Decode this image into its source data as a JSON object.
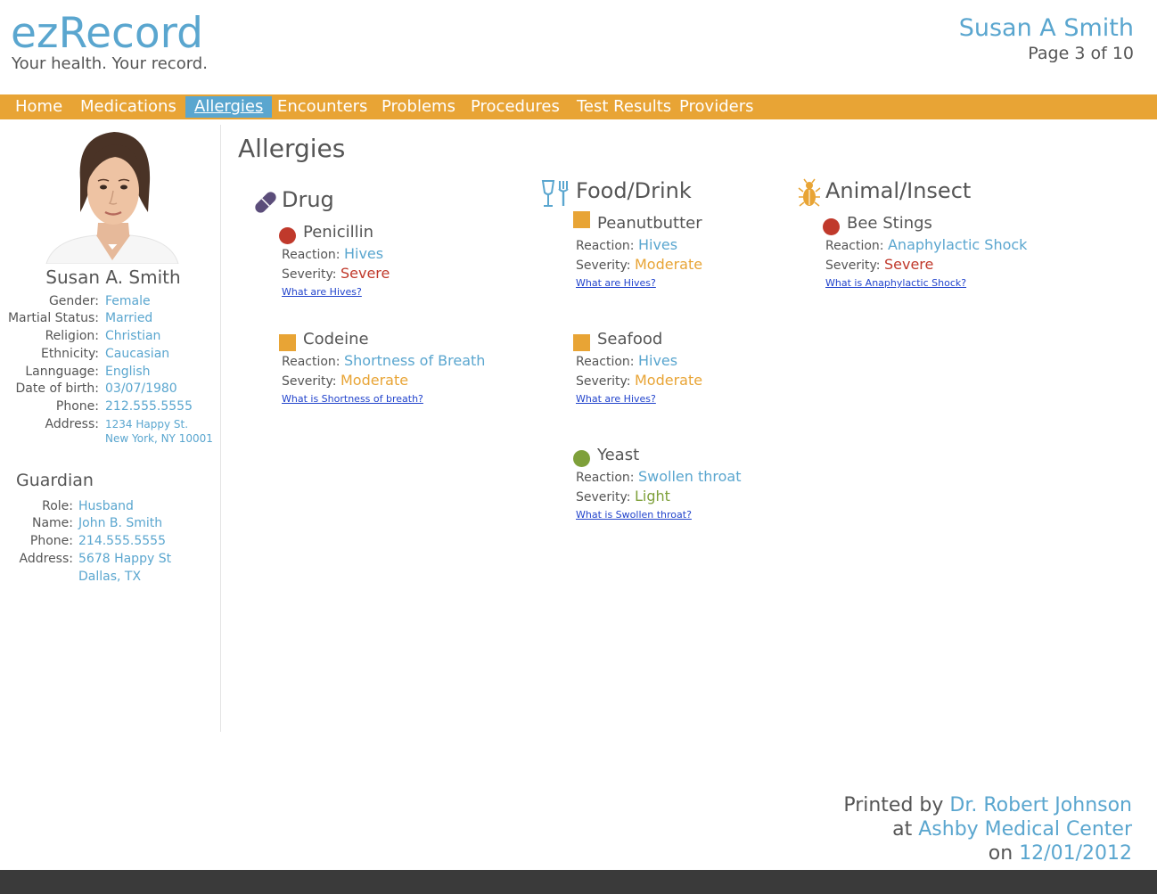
{
  "brand": {
    "logo": "ezRecord",
    "tagline": "Your health. Your record."
  },
  "header": {
    "patient_name": "Susan A Smith",
    "page_indicator": "Page 3 of 10"
  },
  "nav": {
    "items": [
      "Home",
      "Medications",
      "Allergies",
      "Encounters",
      "Problems",
      "Procedures",
      "Test Results",
      "Providers"
    ],
    "active": "Allergies"
  },
  "patient": {
    "name": "Susan A. Smith",
    "fields": [
      {
        "label": "Gender:",
        "value": "Female"
      },
      {
        "label": "Martial Status:",
        "value": "Married"
      },
      {
        "label": "Religion:",
        "value": "Christian"
      },
      {
        "label": "Ethnicity:",
        "value": "Caucasian"
      },
      {
        "label": "Lannguage:",
        "value": "English"
      },
      {
        "label": "Date of birth:",
        "value": "03/07/1980"
      },
      {
        "label": "Phone:",
        "value": "212.555.5555"
      },
      {
        "label": "Address:",
        "value": "1234 Happy St.",
        "value2": "New York, NY 10001"
      }
    ]
  },
  "guardian": {
    "title": "Guardian",
    "fields": [
      {
        "label": "Role:",
        "value": "Husband"
      },
      {
        "label": "Name:",
        "value": "John B. Smith"
      },
      {
        "label": "Phone:",
        "value": "214.555.5555"
      },
      {
        "label": "Address:",
        "value": "5678 Happy St",
        "value2": "Dallas, TX"
      }
    ]
  },
  "main": {
    "title": "Allergies",
    "reaction_label": "Reaction:",
    "severity_label": "Severity:",
    "categories": [
      {
        "name": "Drug",
        "icon": "pill-icon",
        "allergies": [
          {
            "name": "Penicillin",
            "marker": "circle",
            "reaction": "Hives",
            "severity": "Severe",
            "link": "What are Hives?"
          },
          {
            "name": "Codeine",
            "marker": "square",
            "reaction": "Shortness of Breath",
            "severity": "Moderate",
            "link": "What is Shortness of breath?"
          }
        ]
      },
      {
        "name": "Food/Drink",
        "icon": "fork-glass-icon",
        "allergies": [
          {
            "name": "Peanutbutter",
            "marker": "square",
            "reaction": "Hives",
            "severity": "Moderate",
            "link": "What are Hives?"
          },
          {
            "name": "Seafood",
            "marker": "square",
            "reaction": "Hives",
            "severity": "Moderate",
            "link": "What are Hives?"
          },
          {
            "name": "Yeast",
            "marker": "circle",
            "reaction": "Swollen throat",
            "severity": "Light",
            "link": "What is Swollen throat?"
          }
        ]
      },
      {
        "name": "Animal/Insect",
        "icon": "bug-icon",
        "allergies": [
          {
            "name": "Bee Stings",
            "marker": "circle",
            "reaction": "Anaphylactic Shock",
            "severity": "Severe",
            "link": "What is Anaphylactic Shock?"
          }
        ]
      }
    ]
  },
  "footer": {
    "printed_by_label": "Printed by",
    "printed_by": "Dr. Robert Johnson",
    "at_label": "at",
    "location": "Ashby Medical Center",
    "on_label": "on",
    "date": "12/01/2012"
  },
  "colors": {
    "accent_blue": "#5aa6cf",
    "nav_orange": "#e8a435",
    "severe": "#c0392b",
    "moderate": "#e8a435",
    "light": "#7ea03a",
    "drug_icon": "#5b4d7a",
    "footer_bar": "#3a3a3a"
  }
}
